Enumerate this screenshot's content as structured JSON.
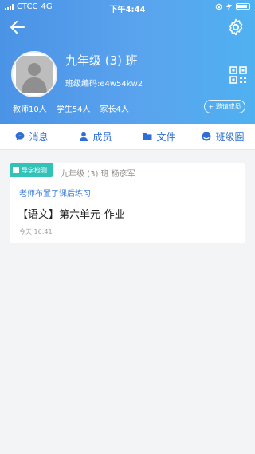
{
  "status_bar": {
    "carrier": "CTCC",
    "network": "4G",
    "time": "下午4:44"
  },
  "header": {
    "class_name": "九年级 (3) 班",
    "class_code": "班级编码:e4w54kw2",
    "stats": {
      "teachers": "教师10人",
      "students": "学生54人",
      "parents": "家长4人"
    },
    "invite_label": "+ 邀请成员"
  },
  "tabs": [
    {
      "label": "消息",
      "icon": "chat-icon"
    },
    {
      "label": "成员",
      "icon": "person-icon"
    },
    {
      "label": "文件",
      "icon": "folder-icon"
    },
    {
      "label": "班级圈",
      "icon": "circle-icon"
    }
  ],
  "feed": [
    {
      "badge": "导学检测",
      "source": "九年级 (3) 班 杨彦军",
      "subtitle": "老师布置了课后练习",
      "title": "【语文】第六单元-作业",
      "time": "今天 16:41"
    }
  ],
  "colors": {
    "header_gradient_start": "#4a93e6",
    "header_gradient_end": "#4fb1f0",
    "accent": "#2e6fd6",
    "badge": "#33c2b8"
  }
}
